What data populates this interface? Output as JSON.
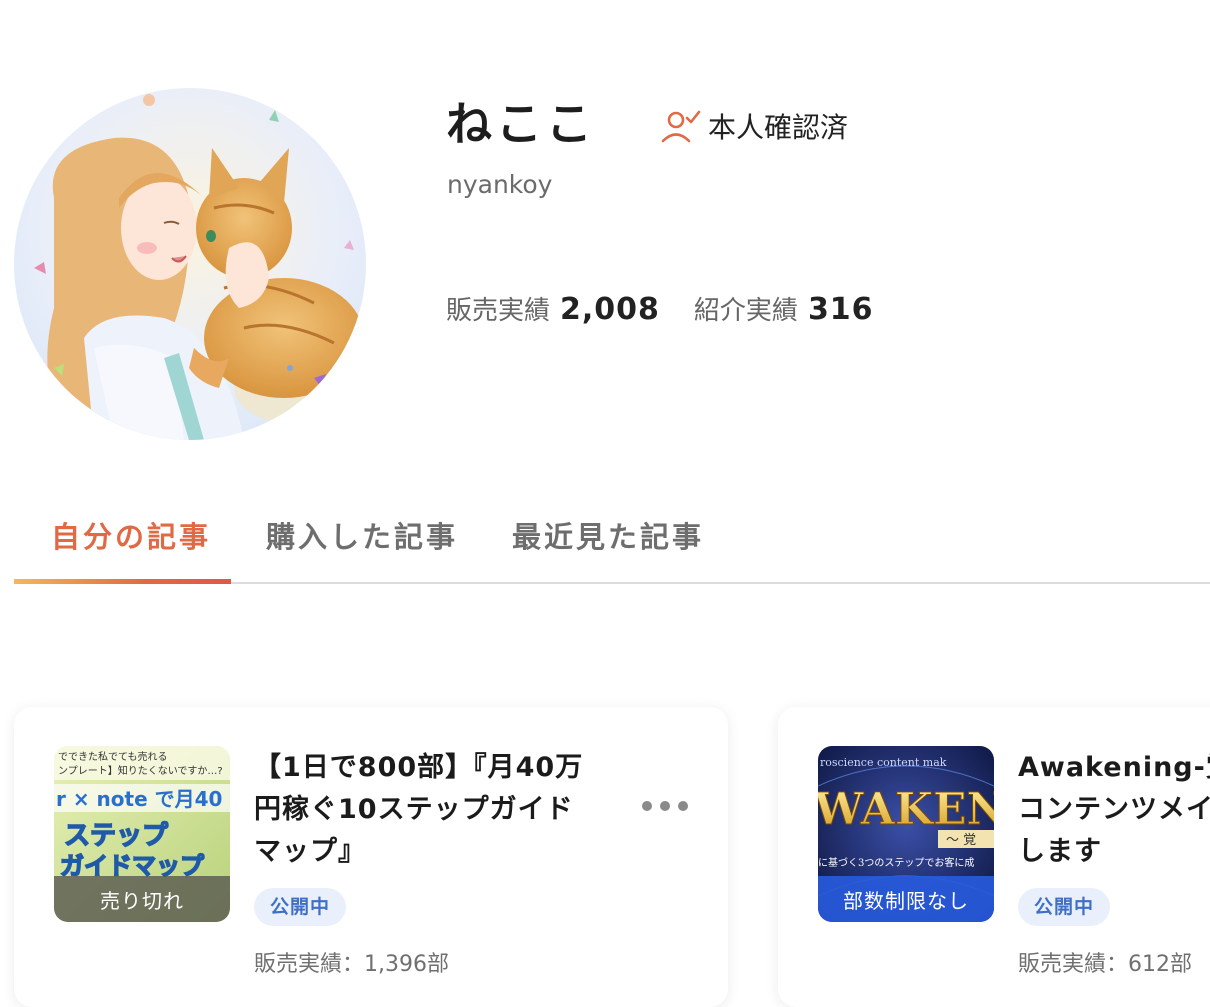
{
  "profile": {
    "name": "ねここ",
    "verified_label": "本人確認済",
    "handle": "nyankoy",
    "stats": {
      "sales_label": "販売実績",
      "sales_value": "2,008",
      "referral_label": "紹介実績",
      "referral_value": "316"
    }
  },
  "tabs": [
    {
      "label": "自分の記事",
      "active": true
    },
    {
      "label": "購入した記事",
      "active": false
    },
    {
      "label": "最近見た記事",
      "active": false
    }
  ],
  "articles": [
    {
      "title": "【1日で800部】『月40万円稼ぐ10ステップガイドマップ』",
      "thumb_badge": "売り切れ",
      "thumb_text": {
        "line1": "でできた私でても売れる",
        "line2": "ンプレート】知りたくないですか…?",
        "brand": "r × note で月40",
        "big1": "ステップ",
        "big2": "ガイドマップ"
      },
      "status": "公開中",
      "sales": "販売実績：1,396部"
    },
    {
      "title": "Awakening-覚\nコンテンツメイ\nします",
      "thumb_badge": "部数制限なし",
      "thumb_text": {
        "top": "roscience content mak",
        "big": "WAKENIN",
        "sub": "〜 覚",
        "line": "に基づく3つのステップでお客に成"
      },
      "status": "公開中",
      "sales": "販売実績：612部"
    }
  ],
  "colors": {
    "accent": "#e06a43",
    "status_bg": "#eaf0fb",
    "status_text": "#3f6fc6"
  },
  "icons": {
    "verified": "person-check-icon",
    "more": "more-horizontal-icon"
  }
}
